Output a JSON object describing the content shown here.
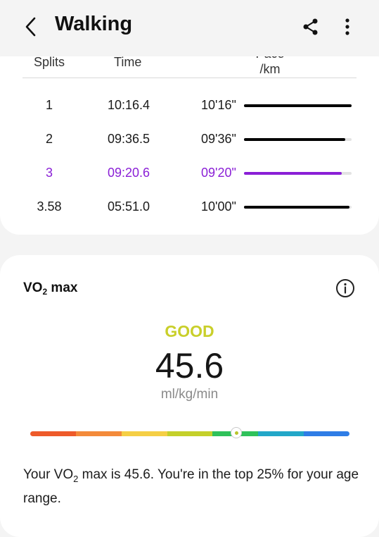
{
  "header": {
    "title": "Walking",
    "icons": {
      "back": "chevron-left-icon",
      "share": "share-icon",
      "more": "more-vertical-icon"
    }
  },
  "splits": {
    "headers": {
      "split": "Splits",
      "time": "Time",
      "pace_line1": "Pace",
      "pace_line2": "/km"
    },
    "rows": [
      {
        "split": "1",
        "time": "10:16.4",
        "pace": "10'16\"",
        "bar_fraction": 1.0,
        "active": false
      },
      {
        "split": "2",
        "time": "09:36.5",
        "pace": "09'36\"",
        "bar_fraction": 0.94,
        "active": false
      },
      {
        "split": "3",
        "time": "09:20.6",
        "pace": "09'20\"",
        "bar_fraction": 0.91,
        "active": true
      },
      {
        "split": "3.58",
        "time": "05:51.0",
        "pace": "10'00\"",
        "bar_fraction": 0.98,
        "active": false
      }
    ],
    "active_color": "#8a1fd6"
  },
  "vo2": {
    "title_main": "VO",
    "title_sub": "2",
    "title_rest": " max",
    "status": "GOOD",
    "value": "45.6",
    "unit": "ml/kg/min",
    "scale_colors": [
      "#ee5a2a",
      "#f38a3a",
      "#f5cf45",
      "#c4d02a",
      "#2fc15a",
      "#22a7c8",
      "#2f7de6"
    ],
    "marker_fraction": 0.645,
    "status_color": "#c9cf2a",
    "desc_part1": "Your VO",
    "desc_sub": "2",
    "desc_part2": " max is 45.6. You're in the top 25% for your age range."
  }
}
